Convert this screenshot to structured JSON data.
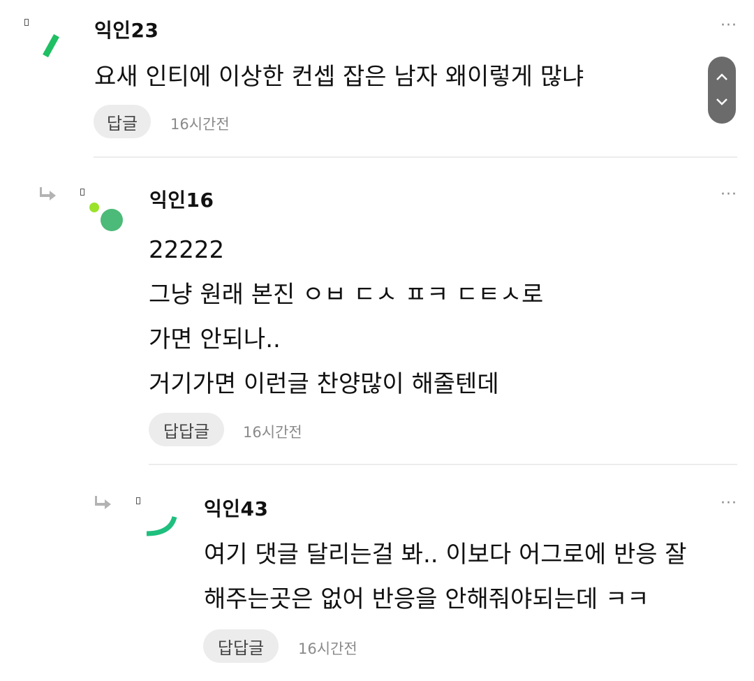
{
  "comments": [
    {
      "author": "익인23",
      "lines": [
        "요새 인티에 이상한 컨셉 잡은 남자 왜이렇게 많냐"
      ],
      "reply_label": "답글",
      "time": "16시간전",
      "more": "···"
    },
    {
      "author": "익인16",
      "lines": [
        "22222",
        "그냥 원래 본진 ㅇㅂ ㄷㅅ ㅍㅋ ㄷㅌㅅ로",
        "가면 안되나..",
        "거기가면 이런글 찬양많이 해줄텐데"
      ],
      "reply_label": "답답글",
      "time": "16시간전",
      "more": "···"
    },
    {
      "author": "익인43",
      "lines": [
        "여기 댓글 달리는걸 봐.. 이보다 어그로에 반응 잘",
        "해주는곳은 없어 반응을 안해줘야되는데 ㅋㅋ"
      ],
      "reply_label": "답답글",
      "time": "16시간전",
      "more": "···"
    }
  ],
  "colors": {
    "avatar_green": "#1fbf63",
    "avatar_green_soft": "#4cba78",
    "dot_lime": "#9be22a",
    "scroll_bg": "#6b6b6b"
  },
  "icons": {
    "reply_arrow": "reply-arrow-icon",
    "scroll_up": "chevron-up-icon",
    "scroll_down": "chevron-down-icon",
    "more": "more-dots-icon"
  }
}
